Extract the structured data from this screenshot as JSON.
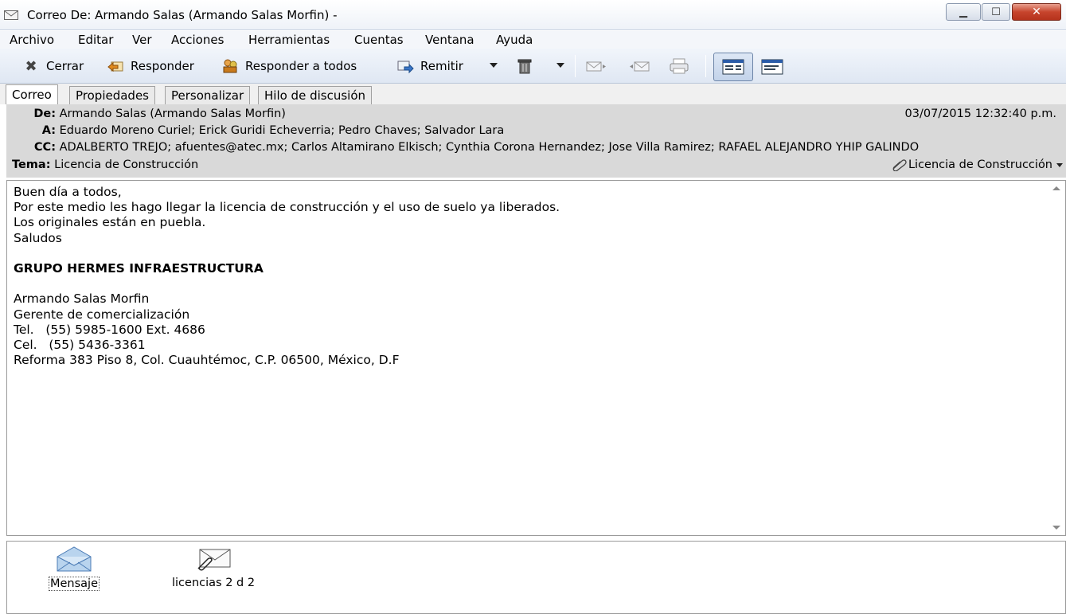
{
  "window": {
    "title": "Correo De: Armando Salas (Armando Salas Morfin) -"
  },
  "menu": [
    "Archivo",
    "Editar",
    "Ver",
    "Acciones",
    "Herramientas",
    "Cuentas",
    "Ventana",
    "Ayuda"
  ],
  "toolbar": {
    "close_label": "Cerrar",
    "reply_label": "Responder",
    "reply_all_label": "Responder a todos",
    "forward_label": "Remitir"
  },
  "tabs": [
    "Correo",
    "Propiedades",
    "Personalizar",
    "Hilo de discusión"
  ],
  "header": {
    "from_label": "De:",
    "from": "Armando Salas (Armando Salas Morfin)",
    "date": "03/07/2015 12:32:40 p.m.",
    "to_label": "A:",
    "to": "Eduardo Moreno Curiel; Erick Guridi Echeverria; Pedro Chaves; Salvador Lara",
    "cc_label": "CC:",
    "cc": "ADALBERTO TREJO; afuentes@atec.mx; Carlos Altamirano Elkisch; Cynthia Corona Hernandez; Jose Villa Ramirez; RAFAEL ALEJANDRO YHIP GALINDO",
    "subject_label": "Tema:",
    "subject": "Licencia de Construcción",
    "attachment_link": "Licencia de Construcción"
  },
  "body": {
    "greeting": "Buen día a todos,",
    "line1": "Por este medio les hago llegar la licencia de construcción y el uso de suelo ya liberados.",
    "line2": "Los originales están en puebla.",
    "closing": "Saludos",
    "company": "GRUPO HERMES INFRAESTRUCTURA",
    "sig_name": "Armando Salas Morfin",
    "sig_title": "Gerente de comercialización",
    "sig_tel": "Tel.   (55) 5985-1600 Ext. 4686",
    "sig_cel": "Cel.   (55) 5436-3361",
    "sig_address": "Reforma 383 Piso 8, Col. Cuauhtémoc, C.P. 06500, México, D.F"
  },
  "attachments": [
    {
      "label": "Mensaje",
      "icon": "open-envelope-icon"
    },
    {
      "label": "licencias 2 d 2",
      "icon": "envelope-attachment-icon"
    }
  ]
}
